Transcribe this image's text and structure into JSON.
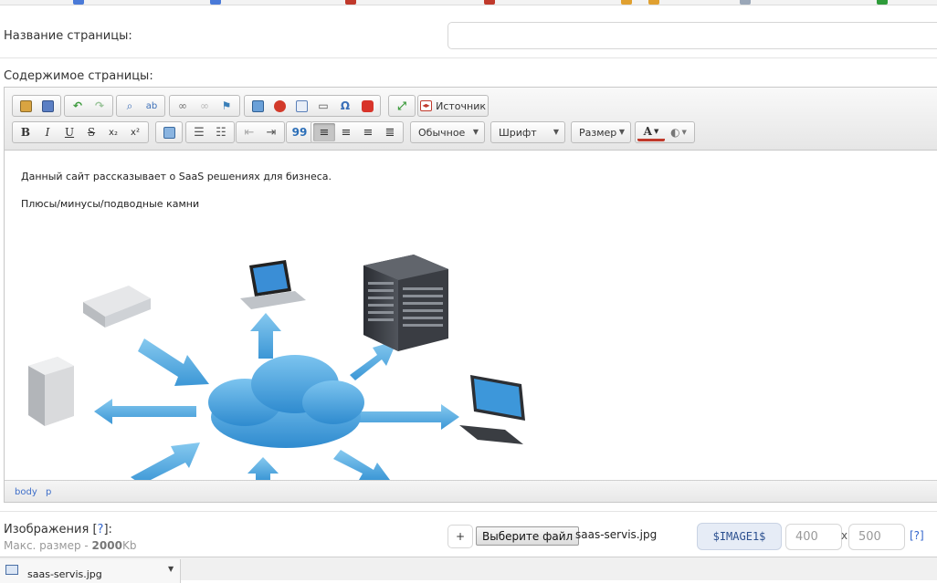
{
  "form": {
    "title_label": "Название страницы:",
    "title_value": "",
    "content_label": "Содержимое страницы:"
  },
  "toolbar": {
    "source_label": "Источник",
    "bold": "B",
    "italic": "I",
    "underline": "U",
    "strike": "S",
    "subscript": "x₂",
    "superscript": "x²",
    "blockquote": "99",
    "format_combo": "Обычное",
    "font_combo": "Шрифт",
    "size_combo": "Размер",
    "text_color": "A"
  },
  "editor": {
    "paragraph_1": "Данный сайт рассказывает о SaaS решениях для бизнеса.",
    "paragraph_2": "Плюсы/минусы/подводные камни",
    "path_body": "body",
    "path_p": "p"
  },
  "images": {
    "label": "Изображения",
    "help_link": "?",
    "max_size_prefix": "Макс. размер - ",
    "max_size_value": "2000",
    "max_size_unit": "Kb",
    "add_button": "+",
    "choose_file_button": "Выберите файл",
    "file_name": "saas-servis.jpg",
    "image_tag": "$IMAGE1$",
    "width_placeholder": "400",
    "height_placeholder": "500",
    "times": "x",
    "dim_help": "[?]"
  },
  "downloads": {
    "file_name": "saas-servis.jpg"
  },
  "colors": {
    "accent_link": "#3366cc",
    "cloud_blue": "#4aa3df",
    "tag_bg": "#e6ecf6"
  }
}
